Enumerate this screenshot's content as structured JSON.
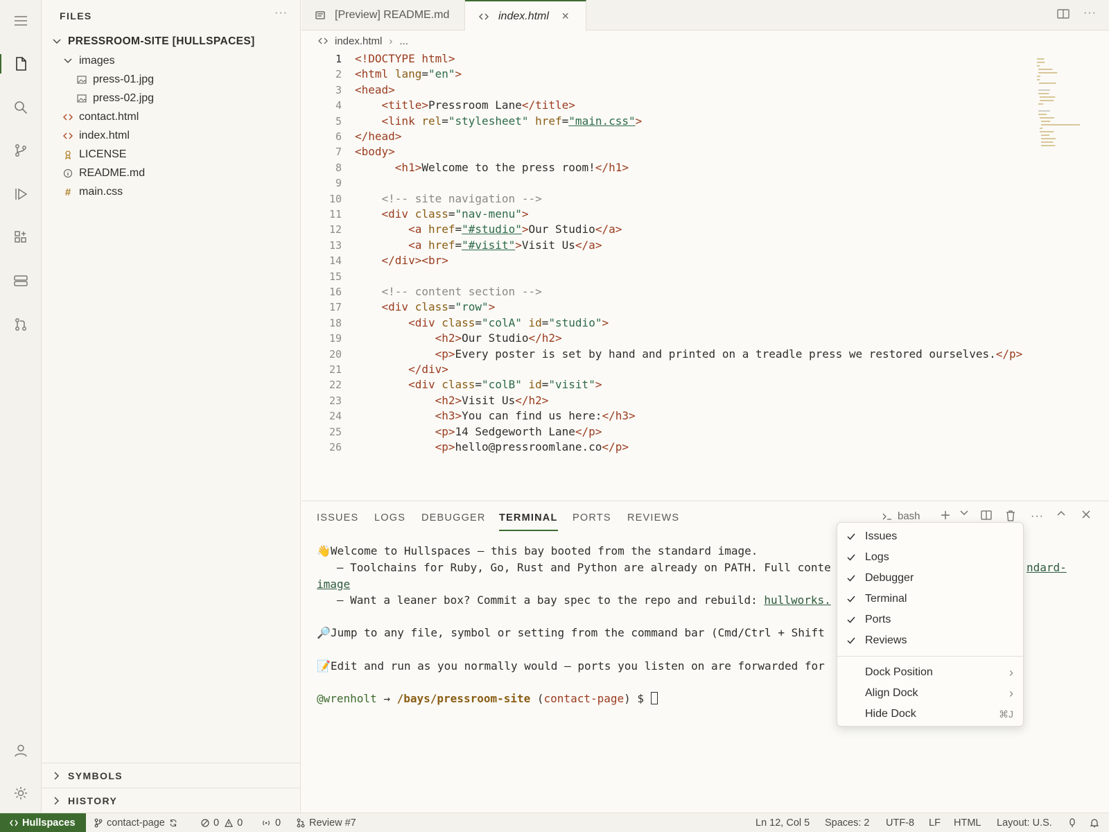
{
  "sidebar": {
    "title": "FILES",
    "more": "···",
    "root": "PRESSROOM-SITE [HULLSPACES]",
    "tree": [
      {
        "label": "images",
        "icon": "chevron-down-icon"
      },
      {
        "label": "press-01.jpg",
        "icon": "image-file-icon"
      },
      {
        "label": "press-02.jpg",
        "icon": "image-file-icon"
      },
      {
        "label": "contact.html",
        "icon": "html-file-icon"
      },
      {
        "label": "index.html",
        "icon": "html-file-icon"
      },
      {
        "label": "LICENSE",
        "icon": "license-file-icon"
      },
      {
        "label": "README.md",
        "icon": "info-file-icon"
      },
      {
        "label": "main.css",
        "icon": "css-hash-icon"
      }
    ],
    "symbols": "SYMBOLS",
    "history": "HISTORY"
  },
  "tabs": [
    {
      "label": "[Preview] README.md",
      "icon": "preview-icon"
    },
    {
      "label": "index.html",
      "icon": "code-icon",
      "close": "✕"
    }
  ],
  "breadcrumb": {
    "file": "index.html",
    "sep": "›",
    "rest": "..."
  },
  "editor": {
    "current_line": 1,
    "lines": [
      "<!DOCTYPE html>",
      "<html lang=\"en\">",
      "<head>",
      "    <title>Pressroom Lane</title>",
      "    <link rel=\"stylesheet\" href=\"main.css\">",
      "</head>",
      "<body>",
      "      <h1>Welcome to the press room!</h1>",
      "",
      "    <!-- site navigation -->",
      "    <div class=\"nav-menu\">",
      "        <a href=\"#studio\">Our Studio</a>",
      "        <a href=\"#visit\">Visit Us</a>",
      "    </div><br>",
      "",
      "    <!-- content section -->",
      "    <div class=\"row\">",
      "        <div class=\"colA\" id=\"studio\">",
      "            <h2>Our Studio</h2>",
      "            <p>Every poster is set by hand and printed on a treadle press we restored ourselves.</p>",
      "        </div>",
      "        <div class=\"colB\" id=\"visit\">",
      "            <h2>Visit Us</h2>",
      "            <h3>You can find us here:</h3>",
      "            <p>14 Sedgeworth Lane</p>",
      "            <p>hello@pressroomlane.co</p>"
    ]
  },
  "panel": {
    "tabs": [
      "ISSUES",
      "LOGS",
      "DEBUGGER",
      "TERMINAL",
      "PORTS",
      "REVIEWS"
    ],
    "active_tab": "TERMINAL",
    "shell": "bash",
    "terminal": {
      "welcome": "👋Welcome to Hullspaces — this bay booted from the standard image.",
      "line2": "   — Toolchains for Ruby, Go, Rust and Python are already on PATH. Full conte",
      "line2_link_tail": "ndard-",
      "line3_link": "image",
      "line4": "   — Want a leaner box? Commit a bay spec to the repo and rebuild: ",
      "line4_link": "hullworks.",
      "line5": "🔎Jump to any file, symbol or setting from the command bar (Cmd/Ctrl + Shift",
      "line6": "📝Edit and run as you normally would — ports you listen on are forwarded for",
      "prompt_user": "@wrenholt",
      "prompt_arrow": " → ",
      "prompt_path": "/bays/pressroom-site",
      "prompt_branch_open": " (",
      "prompt_branch": "contact-page",
      "prompt_branch_close": ") $ "
    }
  },
  "menu": {
    "checked_items": [
      "Issues",
      "Logs",
      "Debugger",
      "Terminal",
      "Ports",
      "Reviews"
    ],
    "items": [
      {
        "label": "Dock Position",
        "right": "›"
      },
      {
        "label": "Align Dock",
        "right": "›"
      },
      {
        "label": "Hide Dock",
        "right": "⌘J"
      }
    ]
  },
  "status": {
    "remote": "Hullspaces",
    "branch": "contact-page",
    "errors": "0",
    "warnings": "0",
    "ports": "0",
    "review": "Review #7",
    "position": "Ln 12, Col 5",
    "spaces": "Spaces: 2",
    "encoding": "UTF-8",
    "eol": "LF",
    "language": "HTML",
    "layout": "Layout: U.S."
  },
  "colors": {
    "accent": "#3d6b2f",
    "tag": "#9a3b1f",
    "attr": "#8a5d14",
    "string": "#2d6a48"
  }
}
